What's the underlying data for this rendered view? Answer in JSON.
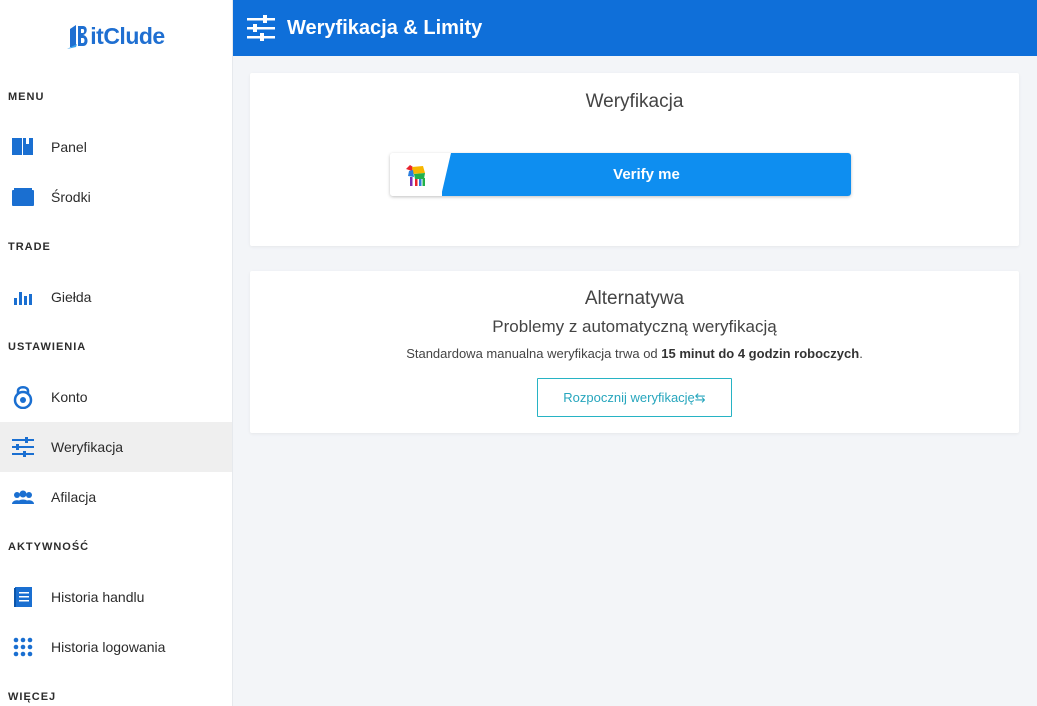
{
  "app": {
    "logo_text": "itClude",
    "page_title": "Weryfikacja & Limity"
  },
  "sidebar": {
    "sections": [
      {
        "title": "MENU",
        "items": [
          {
            "label": "Panel",
            "icon": "panel-icon"
          },
          {
            "label": "Środki",
            "icon": "wallet-icon"
          }
        ]
      },
      {
        "title": "TRADE",
        "items": [
          {
            "label": "Giełda",
            "icon": "bar-chart-icon"
          }
        ]
      },
      {
        "title": "USTAWIENIA",
        "items": [
          {
            "label": "Konto",
            "icon": "lock-icon"
          },
          {
            "label": "Weryfikacja",
            "icon": "sliders-icon",
            "active": true
          },
          {
            "label": "Afilacja",
            "icon": "users-icon"
          }
        ]
      },
      {
        "title": "AKTYWNOŚĆ",
        "items": [
          {
            "label": "Historia handlu",
            "icon": "book-icon"
          },
          {
            "label": "Historia logowania",
            "icon": "grid-dots-icon"
          }
        ]
      },
      {
        "title": "WIĘCEJ",
        "items": []
      }
    ]
  },
  "verification": {
    "title": "Weryfikacja",
    "verify_button": "Verify me"
  },
  "alternative": {
    "title": "Alternatywa",
    "subtitle": "Problemy z automatyczną weryfikacją",
    "desc_prefix": "Standardowa manualna weryfikacja trwa od ",
    "desc_bold": "15 minut do 4 godzin roboczych",
    "desc_suffix": ".",
    "start_button": "Rozpocznij weryfikację⇆"
  },
  "colors": {
    "brand": "#0f6fd9",
    "verify": "#0e8ef0",
    "accent_teal": "#27b3c4"
  }
}
